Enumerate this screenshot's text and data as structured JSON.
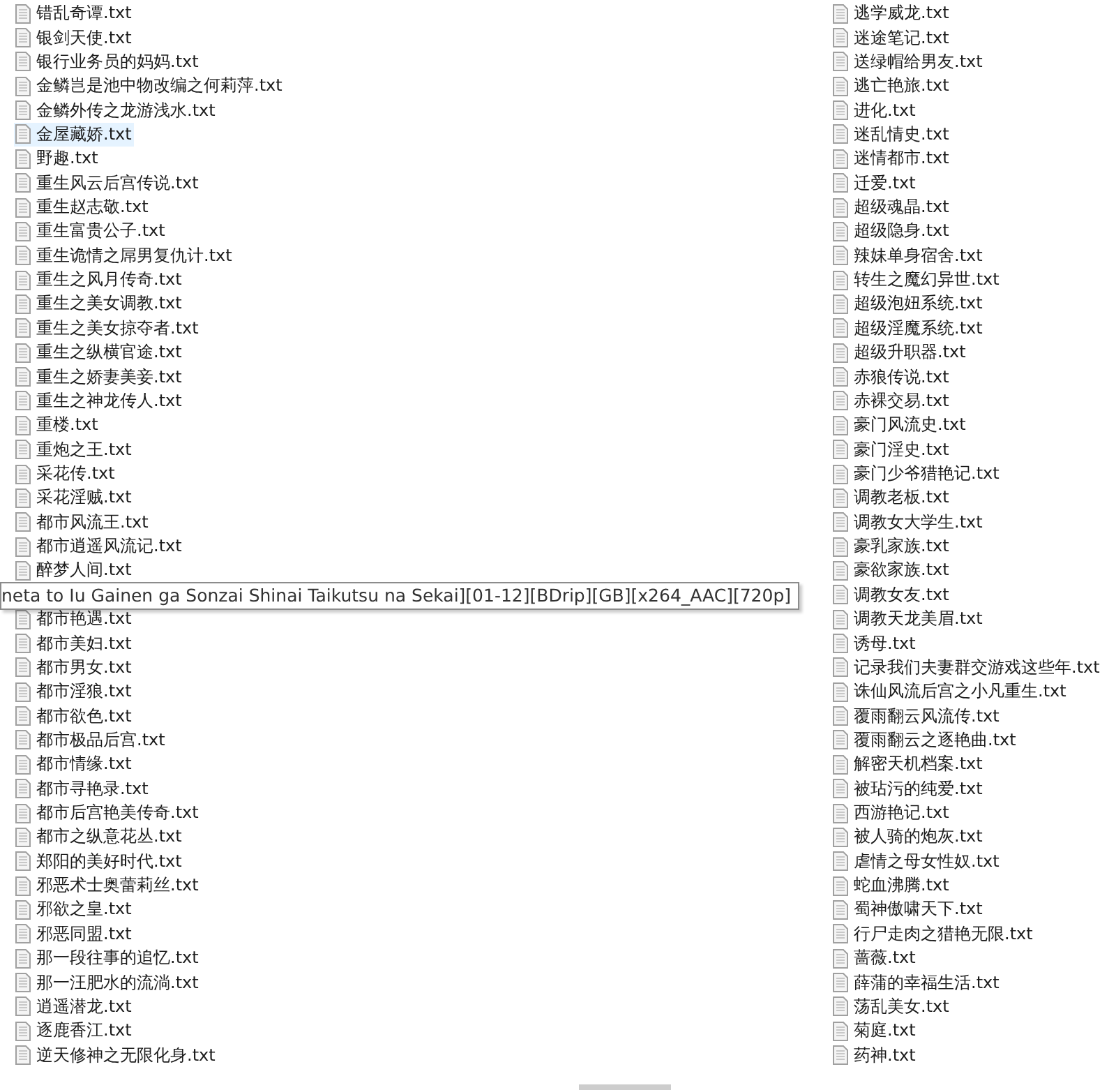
{
  "columns": [
    {
      "items": [
        {
          "kind": "file",
          "name": "错乱奇谭.txt",
          "selected": false
        },
        {
          "kind": "file",
          "name": "银剑天使.txt",
          "selected": false
        },
        {
          "kind": "file",
          "name": "银行业务员的妈妈.txt",
          "selected": false
        },
        {
          "kind": "file",
          "name": "金鳞岂是池中物改编之何莉萍.txt",
          "selected": false
        },
        {
          "kind": "file",
          "name": "金鳞外传之龙游浅水.txt",
          "selected": false
        },
        {
          "kind": "file",
          "name": "金屋藏娇.txt",
          "selected": true
        },
        {
          "kind": "file",
          "name": "野趣.txt",
          "selected": false
        },
        {
          "kind": "file",
          "name": "重生风云后宫传说.txt",
          "selected": false
        },
        {
          "kind": "file",
          "name": "重生赵志敬.txt",
          "selected": false
        },
        {
          "kind": "file",
          "name": "重生富贵公子.txt",
          "selected": false
        },
        {
          "kind": "file",
          "name": "重生诡情之屌男复仇计.txt",
          "selected": false
        },
        {
          "kind": "file",
          "name": "重生之风月传奇.txt",
          "selected": false
        },
        {
          "kind": "file",
          "name": "重生之美女调教.txt",
          "selected": false
        },
        {
          "kind": "file",
          "name": "重生之美女掠夺者.txt",
          "selected": false
        },
        {
          "kind": "file",
          "name": "重生之纵横官途.txt",
          "selected": false
        },
        {
          "kind": "file",
          "name": "重生之娇妻美妾.txt",
          "selected": false
        },
        {
          "kind": "file",
          "name": "重生之神龙传人.txt",
          "selected": false
        },
        {
          "kind": "file",
          "name": "重楼.txt",
          "selected": false
        },
        {
          "kind": "file",
          "name": "重炮之王.txt",
          "selected": false
        },
        {
          "kind": "file",
          "name": "采花传.txt",
          "selected": false
        },
        {
          "kind": "file",
          "name": "采花淫贼.txt",
          "selected": false
        },
        {
          "kind": "file",
          "name": "都市风流王.txt",
          "selected": false
        },
        {
          "kind": "file",
          "name": "都市逍遥风流记.txt",
          "selected": false
        },
        {
          "kind": "file",
          "name": "醉梦人间.txt",
          "selected": false
        },
        {
          "kind": "tooltip",
          "name": "neta to Iu Gainen ga Sonzai Shinai Taikutsu na Sekai][01-12][BDrip][GB][x264_AAC][720p]"
        },
        {
          "kind": "file",
          "name": "都市艳遇.txt",
          "selected": false
        },
        {
          "kind": "file",
          "name": "都市美妇.txt",
          "selected": false
        },
        {
          "kind": "file",
          "name": "都市男女.txt",
          "selected": false
        },
        {
          "kind": "file",
          "name": "都市淫狼.txt",
          "selected": false
        },
        {
          "kind": "file",
          "name": "都市欲色.txt",
          "selected": false
        },
        {
          "kind": "file",
          "name": "都市极品后宫.txt",
          "selected": false
        },
        {
          "kind": "file",
          "name": "都市情缘.txt",
          "selected": false
        },
        {
          "kind": "file",
          "name": "都市寻艳录.txt",
          "selected": false
        },
        {
          "kind": "file",
          "name": "都市后宫艳美传奇.txt",
          "selected": false
        },
        {
          "kind": "file",
          "name": "都市之纵意花丛.txt",
          "selected": false
        },
        {
          "kind": "file",
          "name": "郑阳的美好时代.txt",
          "selected": false
        },
        {
          "kind": "file",
          "name": "邪恶术士奥蕾莉丝.txt",
          "selected": false
        },
        {
          "kind": "file",
          "name": "邪欲之皇.txt",
          "selected": false
        },
        {
          "kind": "file",
          "name": "邪恶同盟.txt",
          "selected": false
        },
        {
          "kind": "file",
          "name": "那一段往事的追忆.txt",
          "selected": false
        },
        {
          "kind": "file",
          "name": "那一汪肥水的流淌.txt",
          "selected": false
        },
        {
          "kind": "file",
          "name": "逍遥潜龙.txt",
          "selected": false
        },
        {
          "kind": "file",
          "name": "逐鹿香江.txt",
          "selected": false
        },
        {
          "kind": "file",
          "name": "逆天修神之无限化身.txt",
          "selected": false
        }
      ]
    },
    {
      "items": [
        {
          "kind": "file",
          "name": "逃学威龙.txt",
          "selected": false
        },
        {
          "kind": "file",
          "name": "迷途笔记.txt",
          "selected": false
        },
        {
          "kind": "file",
          "name": "送绿帽给男友.txt",
          "selected": false
        },
        {
          "kind": "file",
          "name": "逃亡艳旅.txt",
          "selected": false
        },
        {
          "kind": "file",
          "name": "进化.txt",
          "selected": false
        },
        {
          "kind": "file",
          "name": "迷乱情史.txt",
          "selected": false
        },
        {
          "kind": "file",
          "name": "迷情都市.txt",
          "selected": false
        },
        {
          "kind": "file",
          "name": "迁爱.txt",
          "selected": false
        },
        {
          "kind": "file",
          "name": "超级魂晶.txt",
          "selected": false
        },
        {
          "kind": "file",
          "name": "超级隐身.txt",
          "selected": false
        },
        {
          "kind": "file",
          "name": "辣妹单身宿舍.txt",
          "selected": false
        },
        {
          "kind": "file",
          "name": "转生之魔幻异世.txt",
          "selected": false
        },
        {
          "kind": "file",
          "name": "超级泡妞系统.txt",
          "selected": false
        },
        {
          "kind": "file",
          "name": "超级淫魔系统.txt",
          "selected": false
        },
        {
          "kind": "file",
          "name": "超级升职器.txt",
          "selected": false
        },
        {
          "kind": "file",
          "name": "赤狼传说.txt",
          "selected": false
        },
        {
          "kind": "file",
          "name": "赤裸交易.txt",
          "selected": false
        },
        {
          "kind": "file",
          "name": "豪门风流史.txt",
          "selected": false
        },
        {
          "kind": "file",
          "name": "豪门淫史.txt",
          "selected": false
        },
        {
          "kind": "file",
          "name": "豪门少爷猎艳记.txt",
          "selected": false
        },
        {
          "kind": "file",
          "name": "调教老板.txt",
          "selected": false
        },
        {
          "kind": "file",
          "name": "调教女大学生.txt",
          "selected": false
        },
        {
          "kind": "file",
          "name": "豪乳家族.txt",
          "selected": false
        },
        {
          "kind": "file",
          "name": "豪欲家族.txt",
          "selected": false
        },
        {
          "kind": "file",
          "name": "调教女友.txt",
          "selected": false
        },
        {
          "kind": "file",
          "name": "调教天龙美眉.txt",
          "selected": false
        },
        {
          "kind": "file",
          "name": "诱母.txt",
          "selected": false
        },
        {
          "kind": "file",
          "name": "记录我们夫妻群交游戏这些年.txt",
          "selected": false
        },
        {
          "kind": "file",
          "name": "诛仙风流后宫之小凡重生.txt",
          "selected": false
        },
        {
          "kind": "file",
          "name": "覆雨翻云风流传.txt",
          "selected": false
        },
        {
          "kind": "file",
          "name": "覆雨翻云之逐艳曲.txt",
          "selected": false
        },
        {
          "kind": "file",
          "name": "解密天机档案.txt",
          "selected": false
        },
        {
          "kind": "file",
          "name": "被玷污的纯爱.txt",
          "selected": false
        },
        {
          "kind": "file",
          "name": "西游艳记.txt",
          "selected": false
        },
        {
          "kind": "file",
          "name": "被人骑的炮灰.txt",
          "selected": false
        },
        {
          "kind": "file",
          "name": "虐情之母女性奴.txt",
          "selected": false
        },
        {
          "kind": "file",
          "name": "蛇血沸腾.txt",
          "selected": false
        },
        {
          "kind": "file",
          "name": "蜀神傲啸天下.txt",
          "selected": false
        },
        {
          "kind": "file",
          "name": "行尸走肉之猎艳无限.txt",
          "selected": false
        },
        {
          "kind": "file",
          "name": "蔷薇.txt",
          "selected": false
        },
        {
          "kind": "file",
          "name": "薛蒲的幸福生活.txt",
          "selected": false
        },
        {
          "kind": "file",
          "name": "荡乱美女.txt",
          "selected": false
        },
        {
          "kind": "file",
          "name": "菊庭.txt",
          "selected": false
        },
        {
          "kind": "file",
          "name": "药神.txt",
          "selected": false
        }
      ]
    }
  ]
}
